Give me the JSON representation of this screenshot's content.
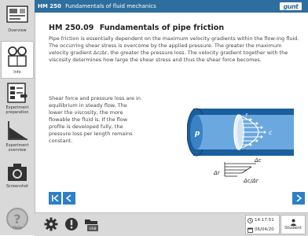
{
  "window": {
    "code": "HM 250",
    "title": "Fundamentals of fluid mechanics",
    "logo": "gunt"
  },
  "sidebar": {
    "items": [
      {
        "label": "Overview",
        "icon": "overview-icon"
      },
      {
        "label": "Info",
        "icon": "glasses-book-icon"
      },
      {
        "label": "Experiment preparation",
        "icon": "clipboard-icon"
      },
      {
        "label": "Experiment overview",
        "icon": "graph-icon"
      },
      {
        "label": "Screenshot",
        "icon": "camera-icon"
      },
      {
        "label": "Help",
        "icon": "help-icon"
      }
    ]
  },
  "main": {
    "heading_code": "HM 250.09",
    "heading_title": "Fundamentals of pipe friction",
    "paragraph1": "Pipe friction is essentially dependent on the maximum velocity gradients within the flow-ing fluid. The occurring shear stress is overcome by the applied pressure. The greater the maximum velocity gradient Δc/Δr, the greater the pressure loss. The velocity gradient together with the viscosity determines how large the shear stress and thus the shear force becomes.",
    "paragraph2": "Shear force and pressure loss are in equilibrium in steady flow. The lower the viscosity, the more flowable the fluid is. If the flow profile is developed fully, the pressure loss per length remains constant."
  },
  "diagram": {
    "labels": {
      "p": "p",
      "c": "c",
      "tau": "τ",
      "dc": "Δc",
      "dr": "Δr",
      "ratio": "Δc/Δr"
    },
    "colors": {
      "pipe": "#1b5e9e",
      "fluid": "#6aa8df",
      "arrows": "#ffffff"
    }
  },
  "nav": {
    "first": "|<",
    "prev": "<",
    "next": ">"
  },
  "bottom": {
    "time": "14:17:51",
    "date": "06/04/20",
    "user": "Student",
    "usb_label": "USB"
  },
  "colors": {
    "titlebar": "#2e6e9e",
    "nav": "#2f7fc8",
    "sidebar": "#d9d9d9"
  }
}
